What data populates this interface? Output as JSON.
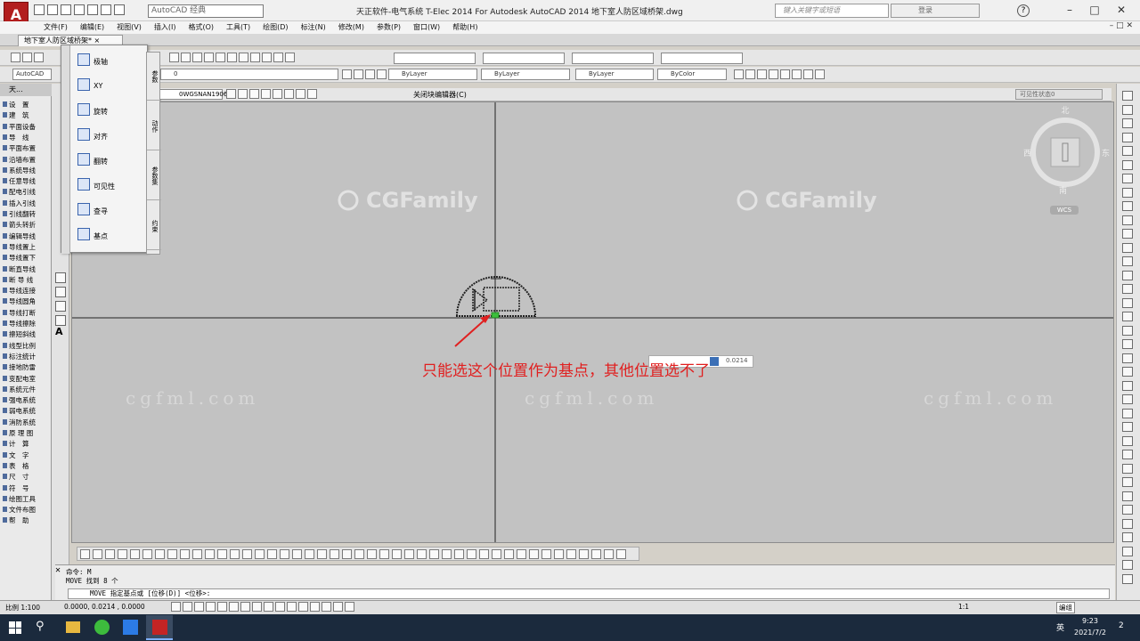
{
  "title_bar": {
    "app_logo": "A",
    "workspace": "AutoCAD 经典",
    "title": "天正软件-电气系统 T-Elec 2014  For Autodesk AutoCAD 2014     地下室人防区域桥架.dwg",
    "search_placeholder": "键入关键字或短语",
    "login": "登录",
    "help": "?"
  },
  "menu": [
    "文件(F)",
    "编辑(E)",
    "视图(V)",
    "插入(I)",
    "格式(O)",
    "工具(T)",
    "绘图(D)",
    "标注(N)",
    "修改(M)",
    "参数(P)",
    "窗口(W)",
    "帮助(H)"
  ],
  "doc_tab": "地下室人防区域桥架*",
  "toolbar": {
    "layer_value": "0",
    "color": "ByLayer",
    "linetype": "ByLayer",
    "lineweight": "ByLayer",
    "plotstyle": "ByColor",
    "style_combo": "AutoCAD",
    "block_name": "0WGSNAN1906)",
    "close_block_editor": "关闭块编辑器(C)",
    "visibility_state": "可见性状态0"
  },
  "left_palette": {
    "header": "天...",
    "items": [
      "设　置",
      "建　筑",
      "平面设备",
      "导　线",
      "平面布置",
      "沿墙布置",
      "系统导线",
      "任意导线",
      "配电引线",
      "插入引线",
      "引线翻转",
      "箭头转折",
      "编辑导线",
      "导线置上",
      "导线置下",
      "断直导线",
      "断 导 线",
      "导线连接",
      "导线圆角",
      "导线打断",
      "导线擦除",
      "擦短斜线",
      "线型比例",
      "标注统计",
      "接地防雷",
      "变配电室",
      "系统元件",
      "强电系统",
      "弱电系统",
      "消防系统",
      "原 理 图",
      "计　算",
      "文　字",
      "表　格",
      "尺　寸",
      "符　号",
      "绘图工具",
      "文件布图",
      "帮　助"
    ]
  },
  "block_authoring_palette": {
    "items": [
      "极轴",
      "XY",
      "旋转",
      "对齐",
      "翻转",
      "可见性",
      "查寻",
      "基点"
    ],
    "tabs": [
      "参数",
      "动作",
      "参数集",
      "约束"
    ]
  },
  "viewcube": {
    "north": "北",
    "south": "南",
    "east": "东",
    "west": "西",
    "wcs": "WCS"
  },
  "annotation": "只能选这个位置作为基点，其他位置选不了",
  "dynamic_input": "0.0214",
  "watermark": {
    "brand": "CGFamily",
    "url": "cgfml.com"
  },
  "command_line": {
    "line1": "命令: M",
    "line2": "MOVE 找到 8 个",
    "prompt": "MOVE 指定基点或 [位移(D)] <位移>:"
  },
  "status_bar": {
    "scale": "比例 1:100",
    "coords": "0.0000, 0.0214 , 0.0000",
    "anno_scale": "1:1",
    "edit": "编组"
  },
  "taskbar": {
    "time": "9:23",
    "date": "2021/7/2",
    "ime": "英",
    "notif": "2"
  },
  "colors": {
    "annotation": "#e02020",
    "canvas": "#c2c2c2",
    "taskbar": "#1b2a3d",
    "app_red": "#b21e1e"
  }
}
